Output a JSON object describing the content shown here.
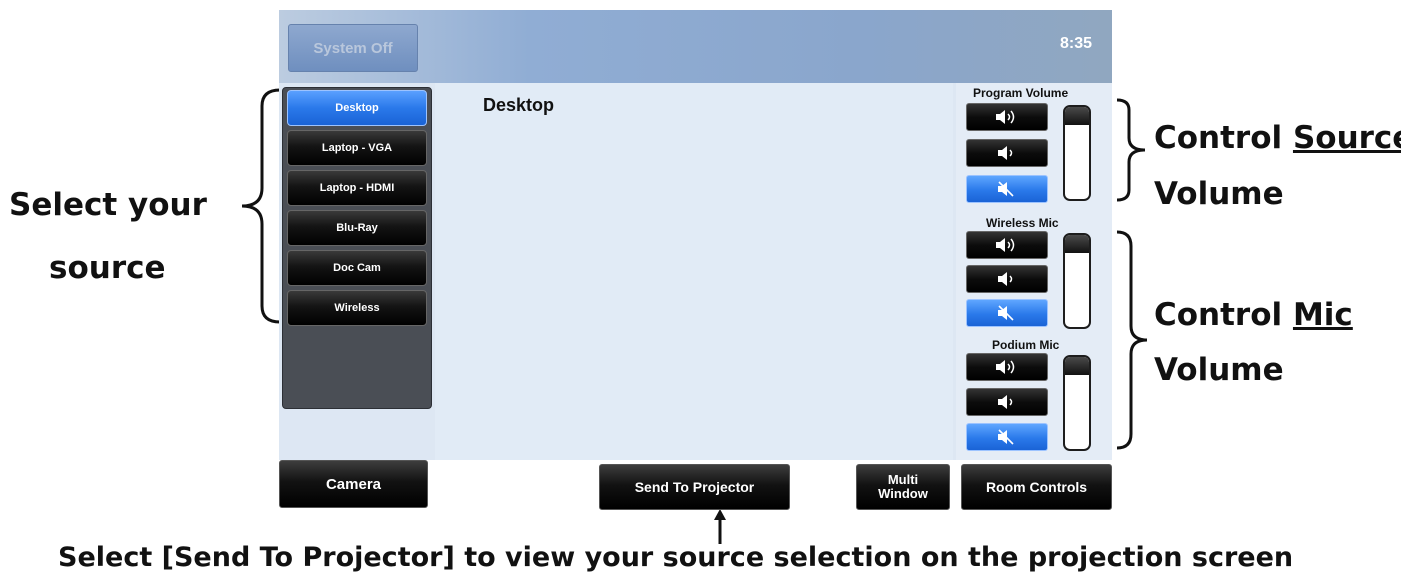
{
  "annotations": {
    "select_source": [
      "Select your",
      "source"
    ],
    "control_source": {
      "prefix": "Control ",
      "underlined": "Source",
      "suffix": "Volume"
    },
    "control_mic": {
      "prefix": "Control ",
      "underlined": "Mic",
      "suffix": "Volume"
    },
    "bottom": "Select [Send To Projector] to view your source selection on the projection screen"
  },
  "header": {
    "system_off_label": "System Off",
    "clock": "8:35"
  },
  "sources": {
    "items": [
      {
        "label": "Desktop",
        "active": true
      },
      {
        "label": "Laptop - VGA",
        "active": false
      },
      {
        "label": "Laptop - HDMI",
        "active": false
      },
      {
        "label": "Blu-Ray",
        "active": false
      },
      {
        "label": "Doc Cam",
        "active": false
      },
      {
        "label": "Wireless",
        "active": false
      }
    ]
  },
  "content": {
    "title": "Desktop"
  },
  "volume_groups": [
    {
      "label": "Program Volume",
      "level": 0.2,
      "muted": true,
      "buttons": [
        "volume-up-icon",
        "volume-down-icon",
        "mute-icon"
      ]
    },
    {
      "label": "Wireless Mic",
      "level": 0.2,
      "muted": true,
      "buttons": [
        "volume-up-icon",
        "volume-down-icon",
        "mute-icon"
      ]
    },
    {
      "label": "Podium Mic",
      "level": 0.2,
      "muted": true,
      "buttons": [
        "volume-up-icon",
        "volume-down-icon",
        "mute-icon"
      ]
    }
  ],
  "bottom_bar": {
    "camera_label": "Camera",
    "send_to_projector_label": "Send To Projector",
    "multi_window_label": [
      "Multi",
      "Window"
    ],
    "room_controls_label": "Room Controls"
  },
  "colors": {
    "active_blue": "#2a79ea",
    "header_blue": "#8aa6cc",
    "content_bg": "#e1ebf6"
  }
}
